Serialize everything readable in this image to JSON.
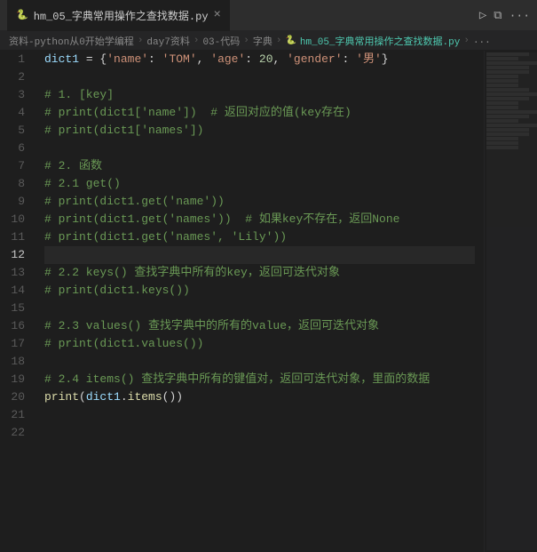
{
  "titlebar": {
    "tab_label": "hm_05_字典常用操作之查找数据.py",
    "close_symbol": "×",
    "run_icon": "▷",
    "split_icon": "⧉",
    "more_icon": "···"
  },
  "breadcrumb": {
    "parts": [
      "资料-python从0开始学编程",
      "day7资料",
      "03-代码",
      "字典",
      "hm_05_字典常用操作之查找数据.py",
      "..."
    ]
  },
  "lines": [
    {
      "num": 1,
      "active": false,
      "tokens": [
        {
          "t": "var",
          "v": "dict1"
        },
        {
          "t": "op",
          "v": " = {"
        },
        {
          "t": "str",
          "v": "'name'"
        },
        {
          "t": "op",
          "v": ": "
        },
        {
          "t": "str",
          "v": "'TOM'"
        },
        {
          "t": "op",
          "v": ", "
        },
        {
          "t": "str",
          "v": "'age'"
        },
        {
          "t": "op",
          "v": ": "
        },
        {
          "t": "num",
          "v": "20"
        },
        {
          "t": "op",
          "v": ", "
        },
        {
          "t": "str",
          "v": "'gender'"
        },
        {
          "t": "op",
          "v": ": "
        },
        {
          "t": "str",
          "v": "'男'"
        },
        {
          "t": "op",
          "v": "}"
        }
      ]
    },
    {
      "num": 2,
      "active": false,
      "tokens": []
    },
    {
      "num": 3,
      "active": false,
      "tokens": [
        {
          "t": "comment",
          "v": "# 1. [key]"
        }
      ]
    },
    {
      "num": 4,
      "active": false,
      "tokens": [
        {
          "t": "comment",
          "v": "# print(dict1['name'])  # 返回对应的值(key存在)"
        }
      ]
    },
    {
      "num": 5,
      "active": false,
      "tokens": [
        {
          "t": "comment",
          "v": "# print(dict1['names'])"
        }
      ]
    },
    {
      "num": 6,
      "active": false,
      "tokens": []
    },
    {
      "num": 7,
      "active": false,
      "tokens": [
        {
          "t": "comment",
          "v": "# 2. 函数"
        }
      ]
    },
    {
      "num": 8,
      "active": false,
      "tokens": [
        {
          "t": "comment",
          "v": "# 2.1 get()"
        }
      ]
    },
    {
      "num": 9,
      "active": false,
      "tokens": [
        {
          "t": "comment",
          "v": "# print(dict1.get('name'))"
        }
      ]
    },
    {
      "num": 10,
      "active": false,
      "tokens": [
        {
          "t": "comment",
          "v": "# print(dict1.get('names'))  # 如果key不存在，返回None"
        }
      ]
    },
    {
      "num": 11,
      "active": false,
      "tokens": [
        {
          "t": "comment",
          "v": "# print(dict1.get('names', 'Lily'))"
        }
      ]
    },
    {
      "num": 12,
      "active": true,
      "tokens": []
    },
    {
      "num": 13,
      "active": false,
      "tokens": [
        {
          "t": "comment",
          "v": "# 2.2 keys() 查找字典中所有的key，返回可迭代对象"
        }
      ]
    },
    {
      "num": 14,
      "active": false,
      "tokens": [
        {
          "t": "comment",
          "v": "# print(dict1.keys())"
        }
      ]
    },
    {
      "num": 15,
      "active": false,
      "tokens": []
    },
    {
      "num": 16,
      "active": false,
      "tokens": [
        {
          "t": "comment",
          "v": "# 2.3 values() 查找字典中的所有的value，返回可迭代对象"
        }
      ]
    },
    {
      "num": 17,
      "active": false,
      "tokens": [
        {
          "t": "comment",
          "v": "# print(dict1.values())"
        }
      ]
    },
    {
      "num": 18,
      "active": false,
      "tokens": []
    },
    {
      "num": 19,
      "active": false,
      "tokens": [
        {
          "t": "comment",
          "v": "# 2.4 items() 查找字典中所有的键值对，返回可迭代对象，里面的数据"
        }
      ]
    },
    {
      "num": 20,
      "active": false,
      "tokens": [
        {
          "t": "fn",
          "v": "print"
        },
        {
          "t": "op",
          "v": "("
        },
        {
          "t": "var",
          "v": "dict1"
        },
        {
          "t": "op",
          "v": "."
        },
        {
          "t": "method",
          "v": "items"
        },
        {
          "t": "op",
          "v": "())"
        }
      ]
    },
    {
      "num": 21,
      "active": false,
      "tokens": []
    },
    {
      "num": 22,
      "active": false,
      "tokens": []
    }
  ]
}
